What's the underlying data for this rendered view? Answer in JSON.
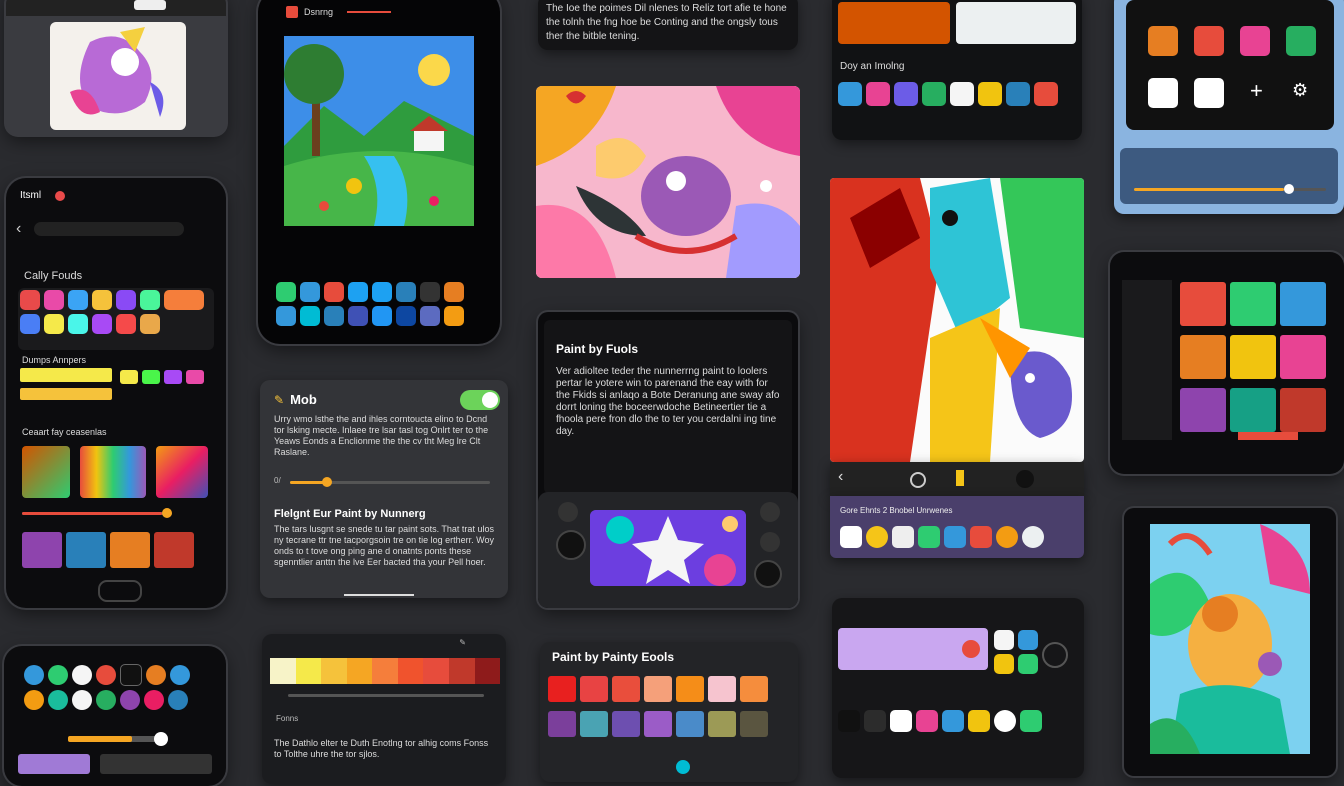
{
  "top_left_tablet": {
    "bar_btn": "——"
  },
  "phone_left": {
    "header": "Itsml",
    "section1": "Cally Fouds",
    "section2": "Dumps Annpers",
    "section3": "Ceaart fay ceasenlas",
    "apps": [
      "#e94a4a",
      "#3ba4f5",
      "#f5c23b",
      "#8a4af5",
      "#4af59a",
      "#f57e3b",
      "#e94aa8",
      "#4a7ef5",
      "#f5e94a",
      "#4af5e9",
      "#a84af5",
      "#f54a4a"
    ]
  },
  "phone_landscape": {
    "header": "Dsnrng",
    "dock_colors": [
      "#2ecc71",
      "#3498db",
      "#e74c3c",
      "#1da1f2",
      "#1da1f2",
      "#555",
      "#e67e22",
      "#3498db",
      "#00bcd4",
      "#2980b9",
      "#e91e63",
      "#3f51b5",
      "#2196f3",
      "#f39c12"
    ]
  },
  "text_card_top": {
    "text": "The Ioe the poimes Dil nlenes to Reliz tort afie te hone the tolnh the fng hoe be Conting and the ongsly tous ther the bitble tening."
  },
  "grid_top_right": {
    "label": "Doy an Imolng"
  },
  "settings_card": {
    "title": "Mob",
    "body": "Urry wmo lsthe the and ihles corntoucta elino to Dcnd tor lsking mecte. Inlaee tre lsar tasl tog Onlrt ter to the Yeaws Eonds a Enclionme the the cv tht Meg lre Clt Raslane.",
    "slider_label": "0/",
    "h2": "Flelgnt Eur Paint by Nunnerg",
    "body2": "The tars lusgnt se snede tu tar paint sots. That trat ulos ny tecrane ttr tne tacporgsoin tre on tie log ertherr. Woy onds to t tove ong ping ane d onatnts ponts these sgenntlier anttn the lve Eer bacted tha your Pell hoer."
  },
  "dark_text_card": {
    "title": "Paint by Fuols",
    "body": "Ver adioltee teder the nunnerrng paint to loolers pertar le yotere win to parenand the eay with for the Fkids si anlaqo a Bote Deranung ane sway afo dorrt loning the boceerwdoche Betineertier tie a fhoola pere fron dlo the to ter you cerdalni ing tine day."
  },
  "palette_card": {
    "title": "Paint by Painty Eools"
  },
  "bottom_left_card": {
    "label": "Fonns",
    "body": "The Dathlo elter te Duth Enotlng tor alhig coms Fonss to Tolthe uhre the tor sjlos."
  },
  "right_tablet": {
    "label": "Gore Ehnts 2 Bnobel Unrwenes"
  },
  "icons": {
    "add": "+",
    "settings": "⚙",
    "back": "‹",
    "home": "⌂",
    "close": "×"
  }
}
